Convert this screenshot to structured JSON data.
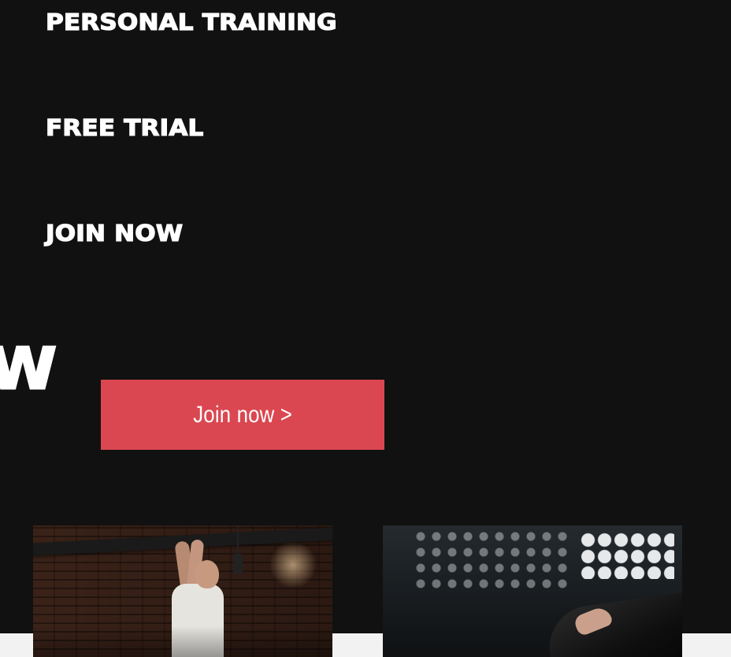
{
  "menu": {
    "items": [
      {
        "label": "PERSONAL TRAINING"
      },
      {
        "label": "FREE TRIAL"
      },
      {
        "label": "JOIN NOW"
      }
    ]
  },
  "marquee": {
    "fragment": "W"
  },
  "cta": {
    "label": "Join now >",
    "color": "#db4750"
  },
  "colors": {
    "background": "#111111",
    "text": "#ffffff",
    "accent": "#db4750",
    "strip": "#f2f2f2"
  },
  "cards": [
    {
      "image": "gym-trainer-photo"
    },
    {
      "image": "gym-lights-photo"
    }
  ]
}
